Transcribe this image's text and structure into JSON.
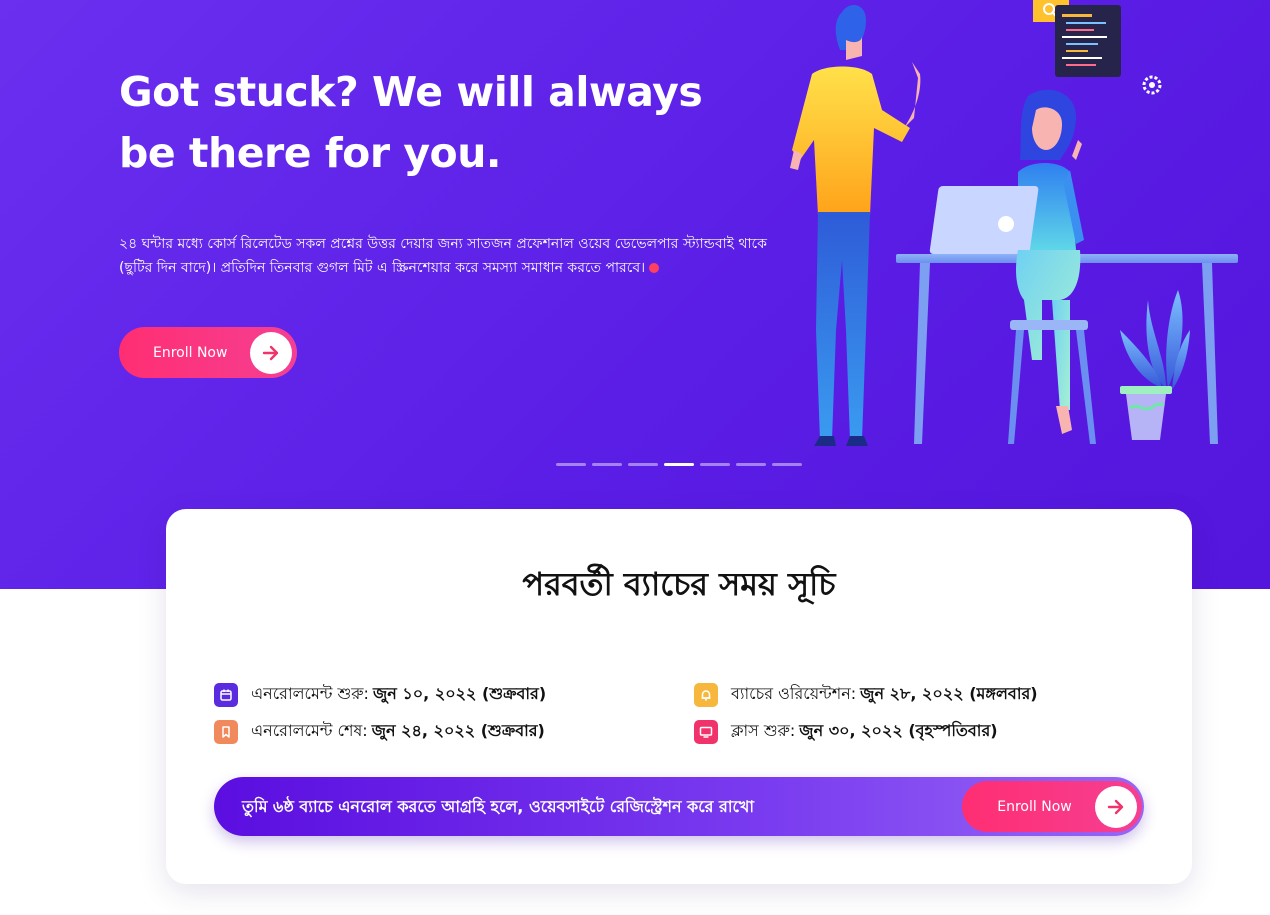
{
  "hero": {
    "title": "Got stuck? We will always be there for you.",
    "description": "২৪ ঘন্টার মধ্যে কোর্স রিলেটেড সকল প্রশ্নের উত্তর দেয়ার জন্য সাতজন প্রফেশনাল ওয়েব ডেভেলপার স্ট্যান্ডবাই থাকে (ছুটির দিন বাদে)। প্রতিদিন তিনবার গুগল মিট এ স্ক্রিনশেয়ার করে সমস্যা সমাধান করতে পারবে।",
    "button_label": "Enroll Now"
  },
  "carousel": {
    "count": 7,
    "active_index": 3
  },
  "schedule": {
    "title": "পরবর্তী ব্যাচের সময় সূচি",
    "items": [
      {
        "label": "এনরোলমেন্ট শুরু:",
        "value": "জুন ১০, ২০২২ (শুক্রবার)",
        "icon": "calendar-icon",
        "color": "#5b2be0"
      },
      {
        "label": "ব্যাচের ওরিয়েন্টশন:",
        "value": "জুন ২৮, ২০২২ (মঙ্গলবার)",
        "icon": "bell-icon",
        "color": "#f6b73c"
      },
      {
        "label": "এনরোলমেন্ট শেষ:",
        "value": "জুন ২৪, ২০২২ (শুক্রবার)",
        "icon": "bookmark-icon",
        "color": "#f08a5d"
      },
      {
        "label": "ক্লাস শুরু:",
        "value": "জুন ৩০, ২০২২ (বৃহস্পতিবার)",
        "icon": "monitor-icon",
        "color": "#f0336b"
      }
    ]
  },
  "banner": {
    "text": "তুমি ৬ষ্ঠ ব্যাচে এনরোল করতে আগ্রহি হলে, ওয়েবসাইটে রেজিস্ট্রেশন করে রাখো",
    "button_label": "Enroll Now"
  },
  "colors": {
    "hero_bg": "#5b1ee6",
    "accent": "#ff2e72",
    "arrow": "#f0336b"
  }
}
